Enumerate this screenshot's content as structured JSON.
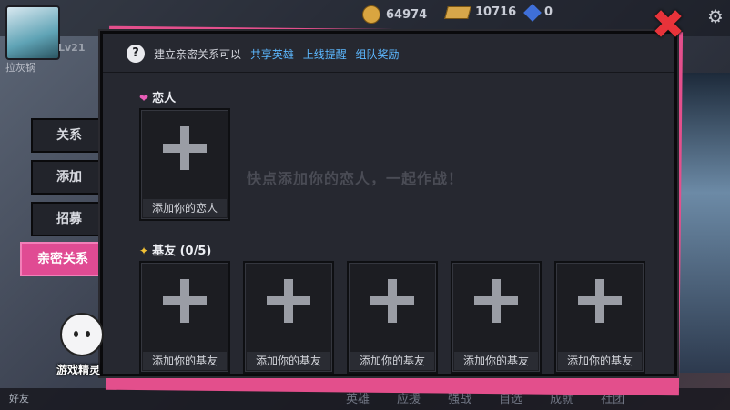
{
  "player": {
    "level": "Lv21",
    "name": "拉灰锅"
  },
  "currencies": [
    {
      "icon": "gold-coin-icon",
      "value": "64974"
    },
    {
      "icon": "gold-bar-icon",
      "value": "10716"
    },
    {
      "icon": "gem-icon",
      "value": "0"
    }
  ],
  "tabs": [
    {
      "label": "关系",
      "active": false
    },
    {
      "label": "添加",
      "active": false
    },
    {
      "label": "招募",
      "active": false
    },
    {
      "label": "亲密关系",
      "active": true
    }
  ],
  "tip": {
    "text": "建立亲密关系可以",
    "links": [
      "共享英雄",
      "上线提醒",
      "组队奖励"
    ]
  },
  "lover_section": {
    "title": "恋人",
    "slot_label": "添加你的恋人",
    "hint": "快点添加你的恋人，一起作战！"
  },
  "buddy_section": {
    "title": "基友 (0/5)",
    "slots": [
      "添加你的基友",
      "添加你的基友",
      "添加你的基友",
      "添加你的基友",
      "添加你的基友"
    ]
  },
  "fairy": {
    "label": "游戏精灵"
  },
  "friend_label": "好友",
  "bottom_nav": [
    "英雄",
    "应援",
    "强战",
    "自选",
    "成就",
    "社团"
  ],
  "colors": {
    "accent": "#e04b93",
    "link": "#5cb8ff",
    "close": "#e8333a"
  }
}
